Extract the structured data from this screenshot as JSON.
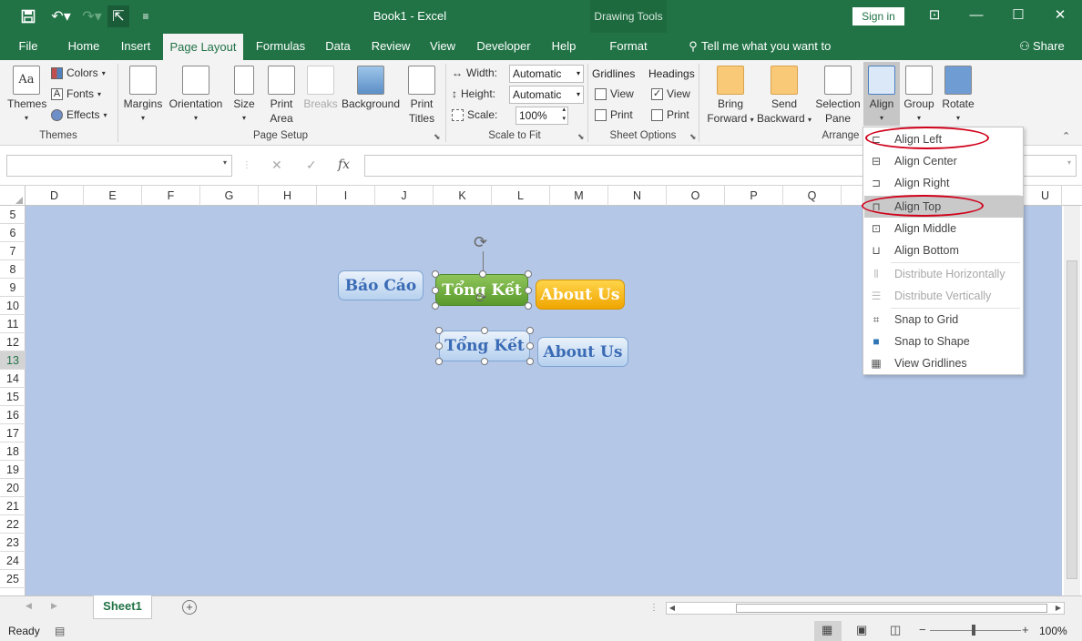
{
  "window": {
    "title": "Book1 - Excel",
    "context_tool": "Drawing Tools",
    "signin": "Sign in"
  },
  "tabs": [
    "File",
    "Home",
    "Insert",
    "Page Layout",
    "Formulas",
    "Data",
    "Review",
    "View",
    "Developer",
    "Help",
    "Format"
  ],
  "active_tab": "Page Layout",
  "tell_me": "Tell me what you want to do",
  "share": "Share",
  "ribbon": {
    "themes": {
      "themes": "Themes",
      "colors": "Colors",
      "fonts": "Fonts",
      "effects": "Effects",
      "group": "Themes"
    },
    "page_setup": {
      "margins": "Margins",
      "orientation": "Orientation",
      "size": "Size",
      "print_area_1": "Print",
      "print_area_2": "Area",
      "breaks": "Breaks",
      "background": "Background",
      "print_titles_1": "Print",
      "print_titles_2": "Titles",
      "group": "Page Setup"
    },
    "scale": {
      "width": "Width:",
      "height": "Height:",
      "scale": "Scale:",
      "width_value": "Automatic",
      "height_value": "Automatic",
      "scale_value": "100%",
      "group": "Scale to Fit"
    },
    "sheet_options": {
      "gridlines": "Gridlines",
      "headings": "Headings",
      "view": "View",
      "print": "Print",
      "group": "Sheet Options"
    },
    "arrange": {
      "bring_1": "Bring",
      "bring_2": "Forward",
      "send_1": "Send",
      "send_2": "Backward",
      "sel_1": "Selection",
      "sel_2": "Pane",
      "align": "Align",
      "group_btn": "Group",
      "rotate": "Rotate",
      "group": "Arrange"
    }
  },
  "columns": [
    "D",
    "E",
    "F",
    "G",
    "H",
    "I",
    "J",
    "K",
    "L",
    "M",
    "N",
    "O",
    "P",
    "Q",
    "U"
  ],
  "rows": [
    "5",
    "6",
    "7",
    "8",
    "9",
    "10",
    "11",
    "12",
    "13",
    "14",
    "15",
    "16",
    "17",
    "18",
    "19",
    "20",
    "21",
    "22",
    "23",
    "24",
    "25"
  ],
  "selected_row": "13",
  "shapes": {
    "bao_cao": "Báo Cáo",
    "tong_ket_1": "Tổng Kết",
    "about_us_1": "About Us",
    "tong_ket_2": "Tổng Kết",
    "about_us_2": "About Us"
  },
  "align_menu": {
    "items": [
      {
        "label": "Align Left",
        "enabled": true,
        "icon": "align-left-icon"
      },
      {
        "label": "Align Center",
        "enabled": true,
        "icon": "align-center-icon"
      },
      {
        "label": "Align Right",
        "enabled": true,
        "icon": "align-right-icon"
      },
      {
        "label": "Align Top",
        "enabled": true,
        "icon": "align-top-icon",
        "highlighted": true
      },
      {
        "label": "Align Middle",
        "enabled": true,
        "icon": "align-middle-icon"
      },
      {
        "label": "Align Bottom",
        "enabled": true,
        "icon": "align-bottom-icon"
      },
      {
        "label": "Distribute Horizontally",
        "enabled": false,
        "icon": "distribute-horizontal-icon"
      },
      {
        "label": "Distribute Vertically",
        "enabled": false,
        "icon": "distribute-vertical-icon"
      },
      {
        "label": "Snap to Grid",
        "enabled": true,
        "icon": "snap-grid-icon"
      },
      {
        "label": "Snap to Shape",
        "enabled": true,
        "icon": "snap-shape-icon"
      },
      {
        "label": "View Gridlines",
        "enabled": true,
        "icon": "view-gridlines-icon"
      }
    ],
    "annotation_color": "#d0021b"
  },
  "sheet_tab": "Sheet1",
  "status": {
    "ready": "Ready",
    "zoom": "100%"
  },
  "colors": {
    "excel_green": "#217346",
    "sheet_background": "#b4c7e7"
  }
}
